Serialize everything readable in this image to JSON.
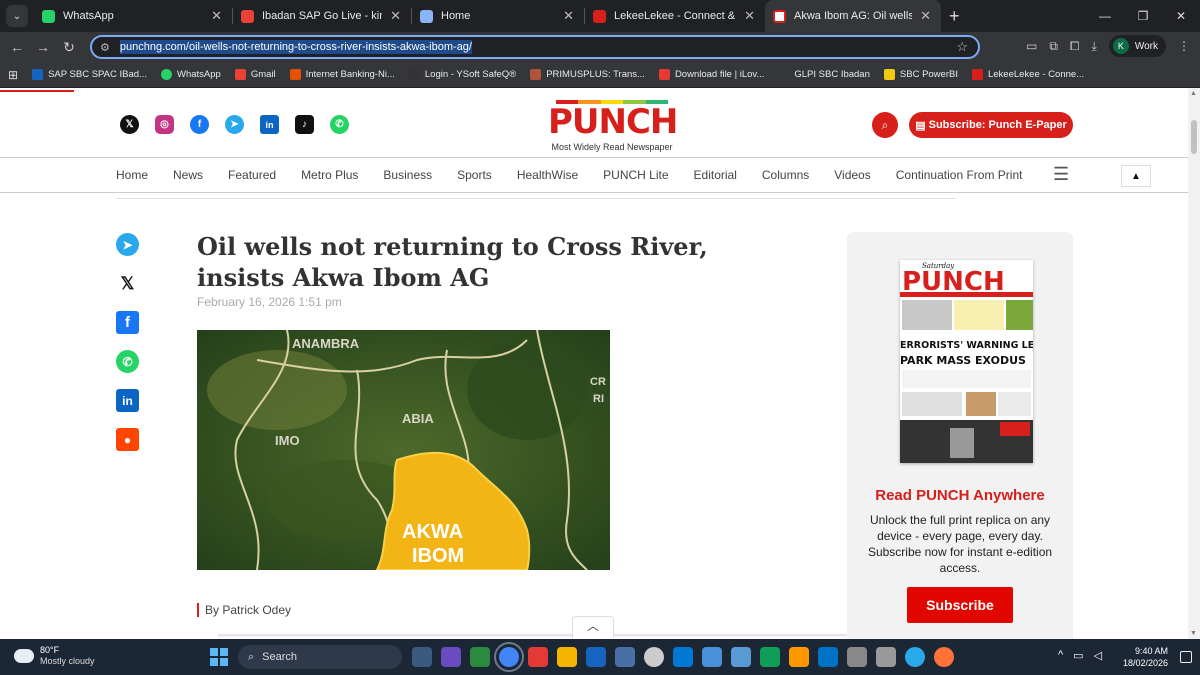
{
  "browser": {
    "tabs": [
      {
        "title": "WhatsApp",
        "color": "#25d366",
        "active": false
      },
      {
        "title": "Ibadan SAP Go Live - kingsley.a",
        "color": "#ea4335",
        "active": false
      },
      {
        "title": "Home",
        "color": "#8ab4f8",
        "active": false
      },
      {
        "title": "LekeeLekee - Connect & Share",
        "color": "#d7201c",
        "active": false
      },
      {
        "title": "Akwa Ibom AG: Oil wells will no",
        "color": "#d7201c",
        "active": true
      }
    ],
    "url": "punchng.com/oil-wells-not-returning-to-cross-river-insists-akwa-ibom-ag/",
    "profile_initial": "K",
    "profile_label": "Work",
    "bookmarks": [
      {
        "label": "SAP SBC SPAC IBad...",
        "color": "#1565c0"
      },
      {
        "label": "WhatsApp",
        "color": "#25d366"
      },
      {
        "label": "Gmail",
        "color": "#ea4335"
      },
      {
        "label": "Internet Banking-Ni...",
        "color": "#e65100"
      },
      {
        "label": "Login - YSoft SafeQ®",
        "color": "#333333"
      },
      {
        "label": "PRIMUSPLUS: Trans...",
        "color": "#b0533b"
      },
      {
        "label": "Download file | iLov...",
        "color": "#e53935"
      },
      {
        "label": "GLPI SBC Ibadan",
        "color": "#35363a"
      },
      {
        "label": "SBC PowerBI",
        "color": "#f2c811"
      },
      {
        "label": "LekeeLekee - Conne...",
        "color": "#d7201c"
      }
    ]
  },
  "site": {
    "logo_text": "PUNCH",
    "tagline": "Most Widely Read Newspaper",
    "subscribe_label": "Subscribe: Punch E-Paper",
    "social_icons": [
      {
        "name": "x-icon",
        "glyph": "𝕏",
        "color": "#111111"
      },
      {
        "name": "instagram-icon",
        "glyph": "◎",
        "color": "#c13584"
      },
      {
        "name": "facebook-icon",
        "glyph": "f",
        "color": "#1877f2"
      },
      {
        "name": "telegram-icon",
        "glyph": "➤",
        "color": "#29a9eb"
      },
      {
        "name": "linkedin-icon",
        "glyph": "in",
        "color": "#0a66c2"
      },
      {
        "name": "tiktok-icon",
        "glyph": "♪",
        "color": "#111111"
      },
      {
        "name": "whatsapp-icon",
        "glyph": "✆",
        "color": "#25d366"
      }
    ],
    "nav": [
      "Home",
      "News",
      "Featured",
      "Metro Plus",
      "Business",
      "Sports",
      "HealthWise",
      "PUNCH Lite",
      "Editorial",
      "Columns",
      "Videos",
      "Continuation From Print"
    ]
  },
  "share": [
    {
      "name": "telegram-share-icon",
      "glyph": "➤",
      "color": "#29a9eb"
    },
    {
      "name": "x-share-icon",
      "glyph": "𝕏",
      "color": "#111111"
    },
    {
      "name": "facebook-share-icon",
      "glyph": "f",
      "color": "#1877f2"
    },
    {
      "name": "whatsapp-share-icon",
      "glyph": "✆",
      "color": "#25d366"
    },
    {
      "name": "linkedin-share-icon",
      "glyph": "in",
      "color": "#0a66c2"
    },
    {
      "name": "reddit-share-icon",
      "glyph": "●",
      "color": "#ff4500"
    }
  ],
  "article": {
    "headline": "Oil wells not returning to Cross River, insists Akwa Ibom AG",
    "date": "February 16, 2026 1:51 pm",
    "byline": "By Patrick Odey",
    "map_labels": [
      "ANAMBRA",
      "IMO",
      "ABIA",
      "AKWA",
      "IBOM",
      "CR",
      "RI"
    ]
  },
  "sidebar": {
    "paper_masthead": "PUNCH",
    "paper_day": "Saturday",
    "paper_headline_1": "ERRORISTS' WARNING LETTER",
    "paper_headline_2": "PARK MASS EXODUS",
    "read_title": "Read PUNCH Anywhere",
    "read_text": "Unlock the full print replica on any device - every page, every day. Subscribe now for instant e-edition access.",
    "subscribe_label": "Subscribe"
  },
  "taskbar": {
    "temperature": "80°F",
    "weather": "Mostly cloudy",
    "search_label": "Search",
    "time": "9:40 AM",
    "date": "18/02/2026",
    "apps": [
      "#3a5a80",
      "#6a4bc2",
      "#2b8a3e",
      "#4285f4",
      "#e53935",
      "#f4b400",
      "#1565c0",
      "#4a6fa5",
      "#cccccc",
      "#0078d4",
      "#4a90d9",
      "#5b9bd5",
      "#ff9800",
      "#0f9d58",
      "#0072c6",
      "#888888",
      "#999999",
      "#29a9eb",
      "#ff7139"
    ]
  }
}
